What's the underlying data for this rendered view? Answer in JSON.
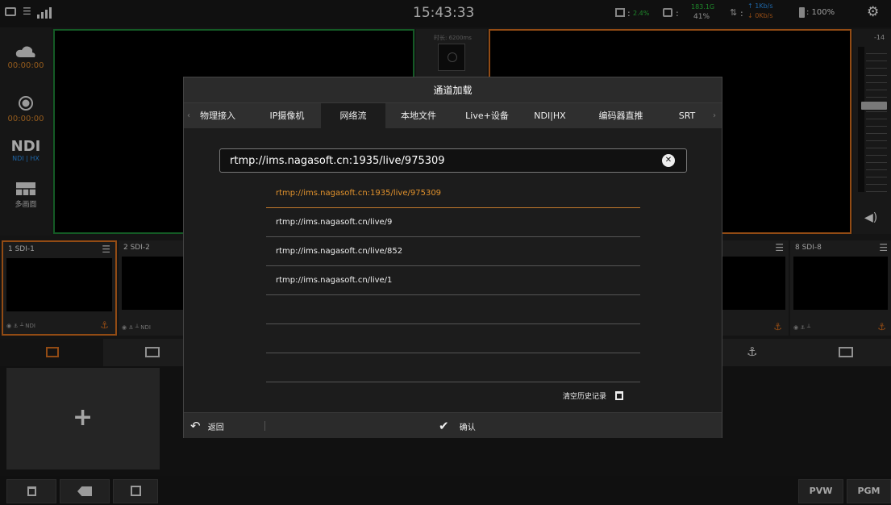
{
  "statusbar": {
    "time": "15:43:33",
    "cpu_value": "2.4%",
    "disk_top": "183.1G",
    "disk_pct": "41%",
    "up_rate": "↑ 1Kb/s",
    "down_rate": "↓ 0Kb/s",
    "battery": ": 100%",
    "colon": ":"
  },
  "leftpanel": {
    "stream_time": "00:00:00",
    "record_time": "00:00:00",
    "ndi_logo": "NDI",
    "ndi_sub": "NDI | HX",
    "multiview": "多画面"
  },
  "center": {
    "time_label": "时长: 6200ms"
  },
  "audio": {
    "top_level": "-14"
  },
  "sources": [
    {
      "label": "1  SDI-1",
      "foot": "◉ ⚓ ┴ NDI"
    },
    {
      "label": "2  SDI-2",
      "foot": "◉ ⚓ ┴ NDI"
    },
    {
      "label": "",
      "foot": ""
    },
    {
      "label": "8  SDI-8",
      "foot": "◉ ⚓ ┴"
    }
  ],
  "dialog": {
    "title": "通道加载",
    "tabs": [
      "物理接入",
      "IP摄像机",
      "网络流",
      "本地文件",
      "Live+设备",
      "NDI|HX",
      "编码器直推",
      "SRT"
    ],
    "url_value": "rtmp://ims.nagasoft.cn:1935/live/975309",
    "history": [
      "rtmp://ims.nagasoft.cn:1935/live/975309",
      "rtmp://ims.nagasoft.cn/live/9",
      "rtmp://ims.nagasoft.cn/live/852",
      "rtmp://ims.nagasoft.cn/live/1"
    ],
    "clear_history": "清空历史记录",
    "back": "返回",
    "confirm": "确认"
  },
  "bottom": {
    "pvw": "PVW",
    "pgm": "PGM"
  },
  "colors": {
    "accent": "#e07320",
    "pvw_border": "#1f8a3a",
    "status_green": "#2ecc40",
    "status_blue": "#2e9bff"
  }
}
